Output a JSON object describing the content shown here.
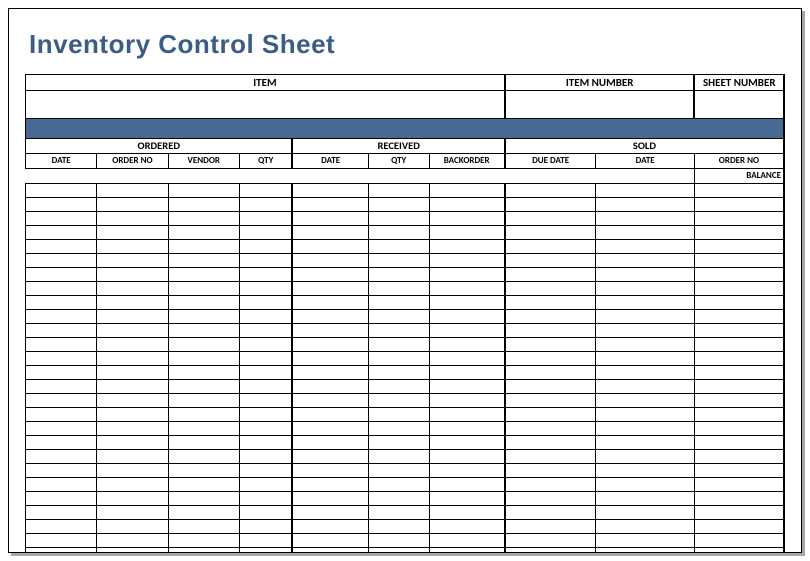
{
  "title": "Inventory Control Sheet",
  "top_headers": {
    "item": "ITEM",
    "item_number": "ITEM NUMBER",
    "sheet_number": "SHEET NUMBER"
  },
  "sections": {
    "ordered": "ORDERED",
    "received": "RECEIVED",
    "sold": "SOLD"
  },
  "columns": {
    "ordered": {
      "date": "DATE",
      "order_no": "ORDER NO",
      "vendor": "VENDOR",
      "qty": "QTY"
    },
    "received": {
      "date": "DATE",
      "qty": "QTY",
      "backorder": "BACKORDER"
    },
    "sold": {
      "due_date": "DUE DATE",
      "date": "DATE",
      "order_no": "ORDER NO"
    }
  },
  "balance_label": "BALANCE",
  "row_count": 27
}
